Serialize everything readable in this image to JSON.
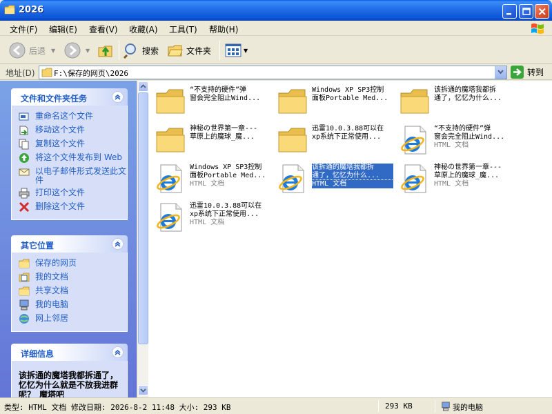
{
  "window": {
    "title": "2026"
  },
  "menu": [
    "文件(F)",
    "编辑(E)",
    "查看(V)",
    "收藏(A)",
    "工具(T)",
    "帮助(H)"
  ],
  "toolbar": {
    "back": "后退",
    "search": "搜索",
    "folders": "文件夹"
  },
  "address": {
    "label": "地址(D)",
    "path": "F:\\保存的网页\\2026",
    "go": "转到"
  },
  "tasks": {
    "title": "文件和文件夹任务",
    "items": [
      {
        "label": "重命名这个文件",
        "icon": "rename-icon"
      },
      {
        "label": "移动这个文件",
        "icon": "move-icon"
      },
      {
        "label": "复制这个文件",
        "icon": "copy-icon"
      },
      {
        "label": "将这个文件发布到 Web",
        "icon": "publish-web-icon"
      },
      {
        "label": "以电子邮件形式发送此文件",
        "icon": "email-icon"
      },
      {
        "label": "打印这个文件",
        "icon": "print-icon"
      },
      {
        "label": "删除这个文件",
        "icon": "delete-icon"
      }
    ]
  },
  "places": {
    "title": "其它位置",
    "items": [
      {
        "label": "保存的网页",
        "icon": "folder-icon"
      },
      {
        "label": "我的文档",
        "icon": "my-documents-icon"
      },
      {
        "label": "共享文档",
        "icon": "shared-documents-icon"
      },
      {
        "label": "我的电脑",
        "icon": "my-computer-icon"
      },
      {
        "label": "网上邻居",
        "icon": "network-icon"
      }
    ]
  },
  "details": {
    "title": "详细信息",
    "text": "该拆通的魔塔我都拆通了，忆忆为什么就是不放我进群呢？_魔塔吧_"
  },
  "files": [
    {
      "name": "“不支持的硬件”弹\n窗会完全阻止Wind...",
      "type": "folder",
      "sub": ""
    },
    {
      "name": "Windows XP SP3控制\n面板Portable Med...",
      "type": "folder",
      "sub": ""
    },
    {
      "name": "该拆通的魔塔我都拆\n通了，忆忆为什么...",
      "type": "folder",
      "sub": ""
    },
    {
      "name": "神秘の世界第一章---\n草原上的魔球_魔...",
      "type": "folder",
      "sub": ""
    },
    {
      "name": "迅雷10.0.3.88可以在\nxp系统下正常使用...",
      "type": "folder",
      "sub": ""
    },
    {
      "name": "“不支持的硬件”弹\n窗会完全阻止Wind...",
      "type": "html",
      "sub": "HTML 文档"
    },
    {
      "name": "Windows XP SP3控制\n面板Portable Med...",
      "type": "html",
      "sub": "HTML 文档"
    },
    {
      "name": "该拆通的魔塔我都拆\n通了，忆忆为什么...",
      "type": "html",
      "sub": "HTML 文档",
      "selected": true
    },
    {
      "name": "神秘の世界第一章---\n草原上的魔球_魔...",
      "type": "html",
      "sub": "HTML 文档"
    },
    {
      "name": "迅雷10.0.3.88可以在\nxp系统下正常使用...",
      "type": "html",
      "sub": "HTML 文档"
    }
  ],
  "status": {
    "info": "类型: HTML 文档 修改日期: 2026-8-2 11:48 大小: 293 KB",
    "size": "293 KB",
    "location": "我的电脑"
  },
  "colors": {
    "titlebar": "#0A5FE6",
    "taskpane": "#7BA2E7",
    "link": "#215DC6",
    "selection": "#316AC5"
  }
}
